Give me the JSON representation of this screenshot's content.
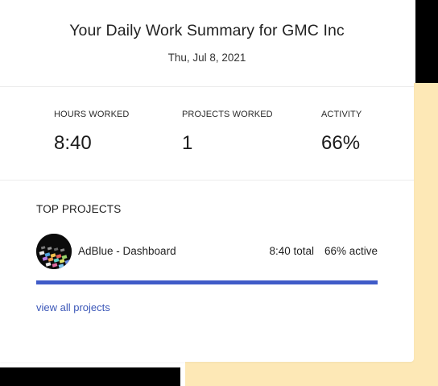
{
  "header": {
    "title": "Your Daily Work Summary for GMC Inc",
    "date": "Thu, Jul 8, 2021"
  },
  "stats": [
    {
      "label": "HOURS WORKED",
      "value": "8:40"
    },
    {
      "label": "PROJECTS WORKED",
      "value": "1"
    },
    {
      "label": "ACTIVITY",
      "value": "66%"
    }
  ],
  "top_projects": {
    "title": "TOP PROJECTS",
    "items": [
      {
        "name": "AdBlue - Dashboard",
        "total": "8:40 total",
        "active": "66% active",
        "progress": 1.0,
        "icon": "project-thumbnail"
      }
    ],
    "view_all_label": "view all projects"
  },
  "colors": {
    "accent": "#3f5bc8",
    "link": "#3b57b8",
    "backdrop_yellow": "#fde8b6",
    "backdrop_black": "#000000"
  }
}
